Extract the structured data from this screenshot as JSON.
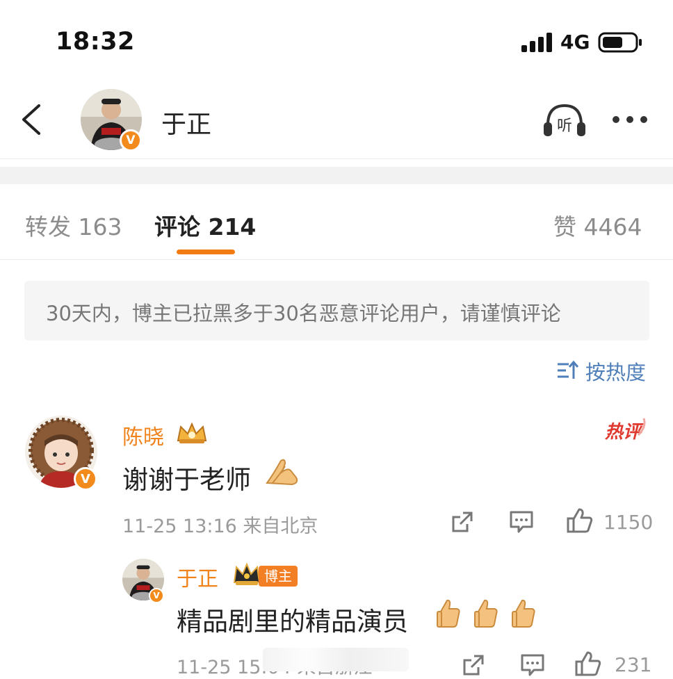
{
  "status_bar": {
    "time": "18:32",
    "network": "4G"
  },
  "header": {
    "title": "于正",
    "verified_mark": "V",
    "listen_icon_label": "听"
  },
  "tabs": [
    {
      "label": "转发 163"
    },
    {
      "label": "评论 214"
    },
    {
      "label": "赞 4464"
    }
  ],
  "notice": "30天内，博主已拉黑多于30名恶意评论用户，请谨慎评论",
  "sort": {
    "label": "按热度"
  },
  "comments": [
    {
      "user": "陈晓",
      "verified_mark": "V",
      "text": "谢谢于老师",
      "hot_label": "热评",
      "meta": "11-25 13:16  来自北京",
      "likes": "1150",
      "replies": [
        {
          "user": "于正",
          "verified_mark": "V",
          "badge": "博主",
          "text": "精品剧里的精品演员",
          "meta": "11-25 15:04  来自浙江",
          "likes": "231"
        }
      ]
    }
  ],
  "colors": {
    "accent": "#f27b14",
    "username": "#f0831b",
    "link": "#4f7fb8",
    "hot": "#e0392f"
  }
}
